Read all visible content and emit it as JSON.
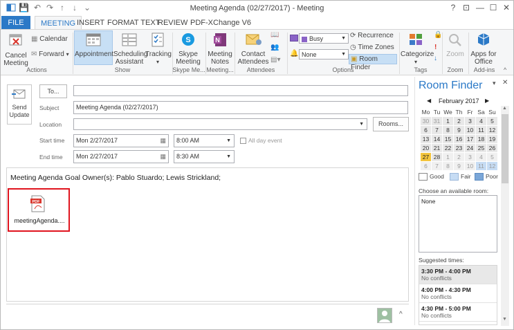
{
  "window": {
    "title": "Meeting Agenda (02/27/2017) - Meeting"
  },
  "quick_access": {
    "save": "💾",
    "undo": "↶",
    "redo": "↷",
    "up": "↑",
    "down": "↓",
    "more": "⌄"
  },
  "window_controls": {
    "help": "?",
    "restore_ribbon": "⊡",
    "minimize": "—",
    "maximize": "☐",
    "close": "✕"
  },
  "tabs": [
    {
      "label": "FILE"
    },
    {
      "label": "MEETING"
    },
    {
      "label": "INSERT"
    },
    {
      "label": "FORMAT TEXT"
    },
    {
      "label": "REVIEW"
    },
    {
      "label": "PDF-XChange V6"
    }
  ],
  "ribbon": {
    "actions": {
      "cancel": "Cancel Meeting",
      "calendar": "Calendar",
      "forward": "Forward",
      "group": "Actions"
    },
    "show": {
      "appointment": "Appointment",
      "scheduling": "Scheduling Assistant",
      "tracking": "Tracking",
      "group": "Show"
    },
    "skype": {
      "button": "Skype Meeting",
      "group": "Skype Me..."
    },
    "meeting_notes": {
      "button": "Meeting Notes",
      "group": "Meeting..."
    },
    "attendees": {
      "button": "Contact Attendees",
      "group": "Attendees"
    },
    "options": {
      "show_as": "Busy",
      "reminder": "None",
      "recurrence": "Recurrence",
      "time_zones": "Time Zones",
      "room_finder": "Room Finder",
      "group": "Options"
    },
    "tags": {
      "categorize": "Categorize",
      "group": "Tags"
    },
    "zoom": {
      "button": "Zoom",
      "group": "Zoom"
    },
    "addins": {
      "button": "Apps for Office",
      "group": "Add-ins"
    }
  },
  "form": {
    "send_update": "Send Update",
    "to_button": "To...",
    "to_value": "",
    "subject_label": "Subject",
    "subject_value": "Meeting Agenda (02/27/2017)",
    "location_label": "Location",
    "location_value": "",
    "rooms_button": "Rooms...",
    "start_label": "Start time",
    "start_date": "Mon 2/27/2017",
    "start_time": "8:00 AM",
    "all_day": "All day event",
    "end_label": "End time",
    "end_date": "Mon 2/27/2017",
    "end_time": "8:30 AM",
    "body_text": "Meeting Agenda Goal Owner(s): Pablo Stuardo; Lewis Strickland;",
    "attachment_name": "meetingAgenda....",
    "attachment_badge": "PDF"
  },
  "room_finder": {
    "title": "Room Finder",
    "month": "February 2017",
    "weekdays": [
      "Mo",
      "Tu",
      "We",
      "Th",
      "Fr",
      "Sa",
      "Su"
    ],
    "weeks": [
      [
        "30",
        "31",
        "1",
        "2",
        "3",
        "4",
        "5"
      ],
      [
        "6",
        "7",
        "8",
        "9",
        "10",
        "11",
        "12"
      ],
      [
        "13",
        "14",
        "15",
        "16",
        "17",
        "18",
        "19"
      ],
      [
        "20",
        "21",
        "22",
        "23",
        "24",
        "25",
        "26"
      ],
      [
        "27",
        "28",
        "1",
        "2",
        "3",
        "4",
        "5"
      ],
      [
        "6",
        "7",
        "8",
        "9",
        "10",
        "11",
        "12"
      ]
    ],
    "legend": {
      "good": "Good",
      "fair": "Fair",
      "poor": "Poor"
    },
    "choose_label": "Choose an available room:",
    "rooms": [
      "None"
    ],
    "suggested_label": "Suggested times:",
    "suggestions": [
      {
        "time": "3:30 PM - 4:00 PM",
        "status": "No conflicts"
      },
      {
        "time": "4:00 PM - 4:30 PM",
        "status": "No conflicts"
      },
      {
        "time": "4:30 PM - 5:00 PM",
        "status": "No conflicts"
      }
    ]
  },
  "colors": {
    "accent": "#2b79c7",
    "selected_day": "#f3c43c",
    "fair": "#c6dcf4",
    "poor": "#7aa6d8",
    "highlight": "#c7dff5",
    "attachment_border": "#e0141e"
  }
}
